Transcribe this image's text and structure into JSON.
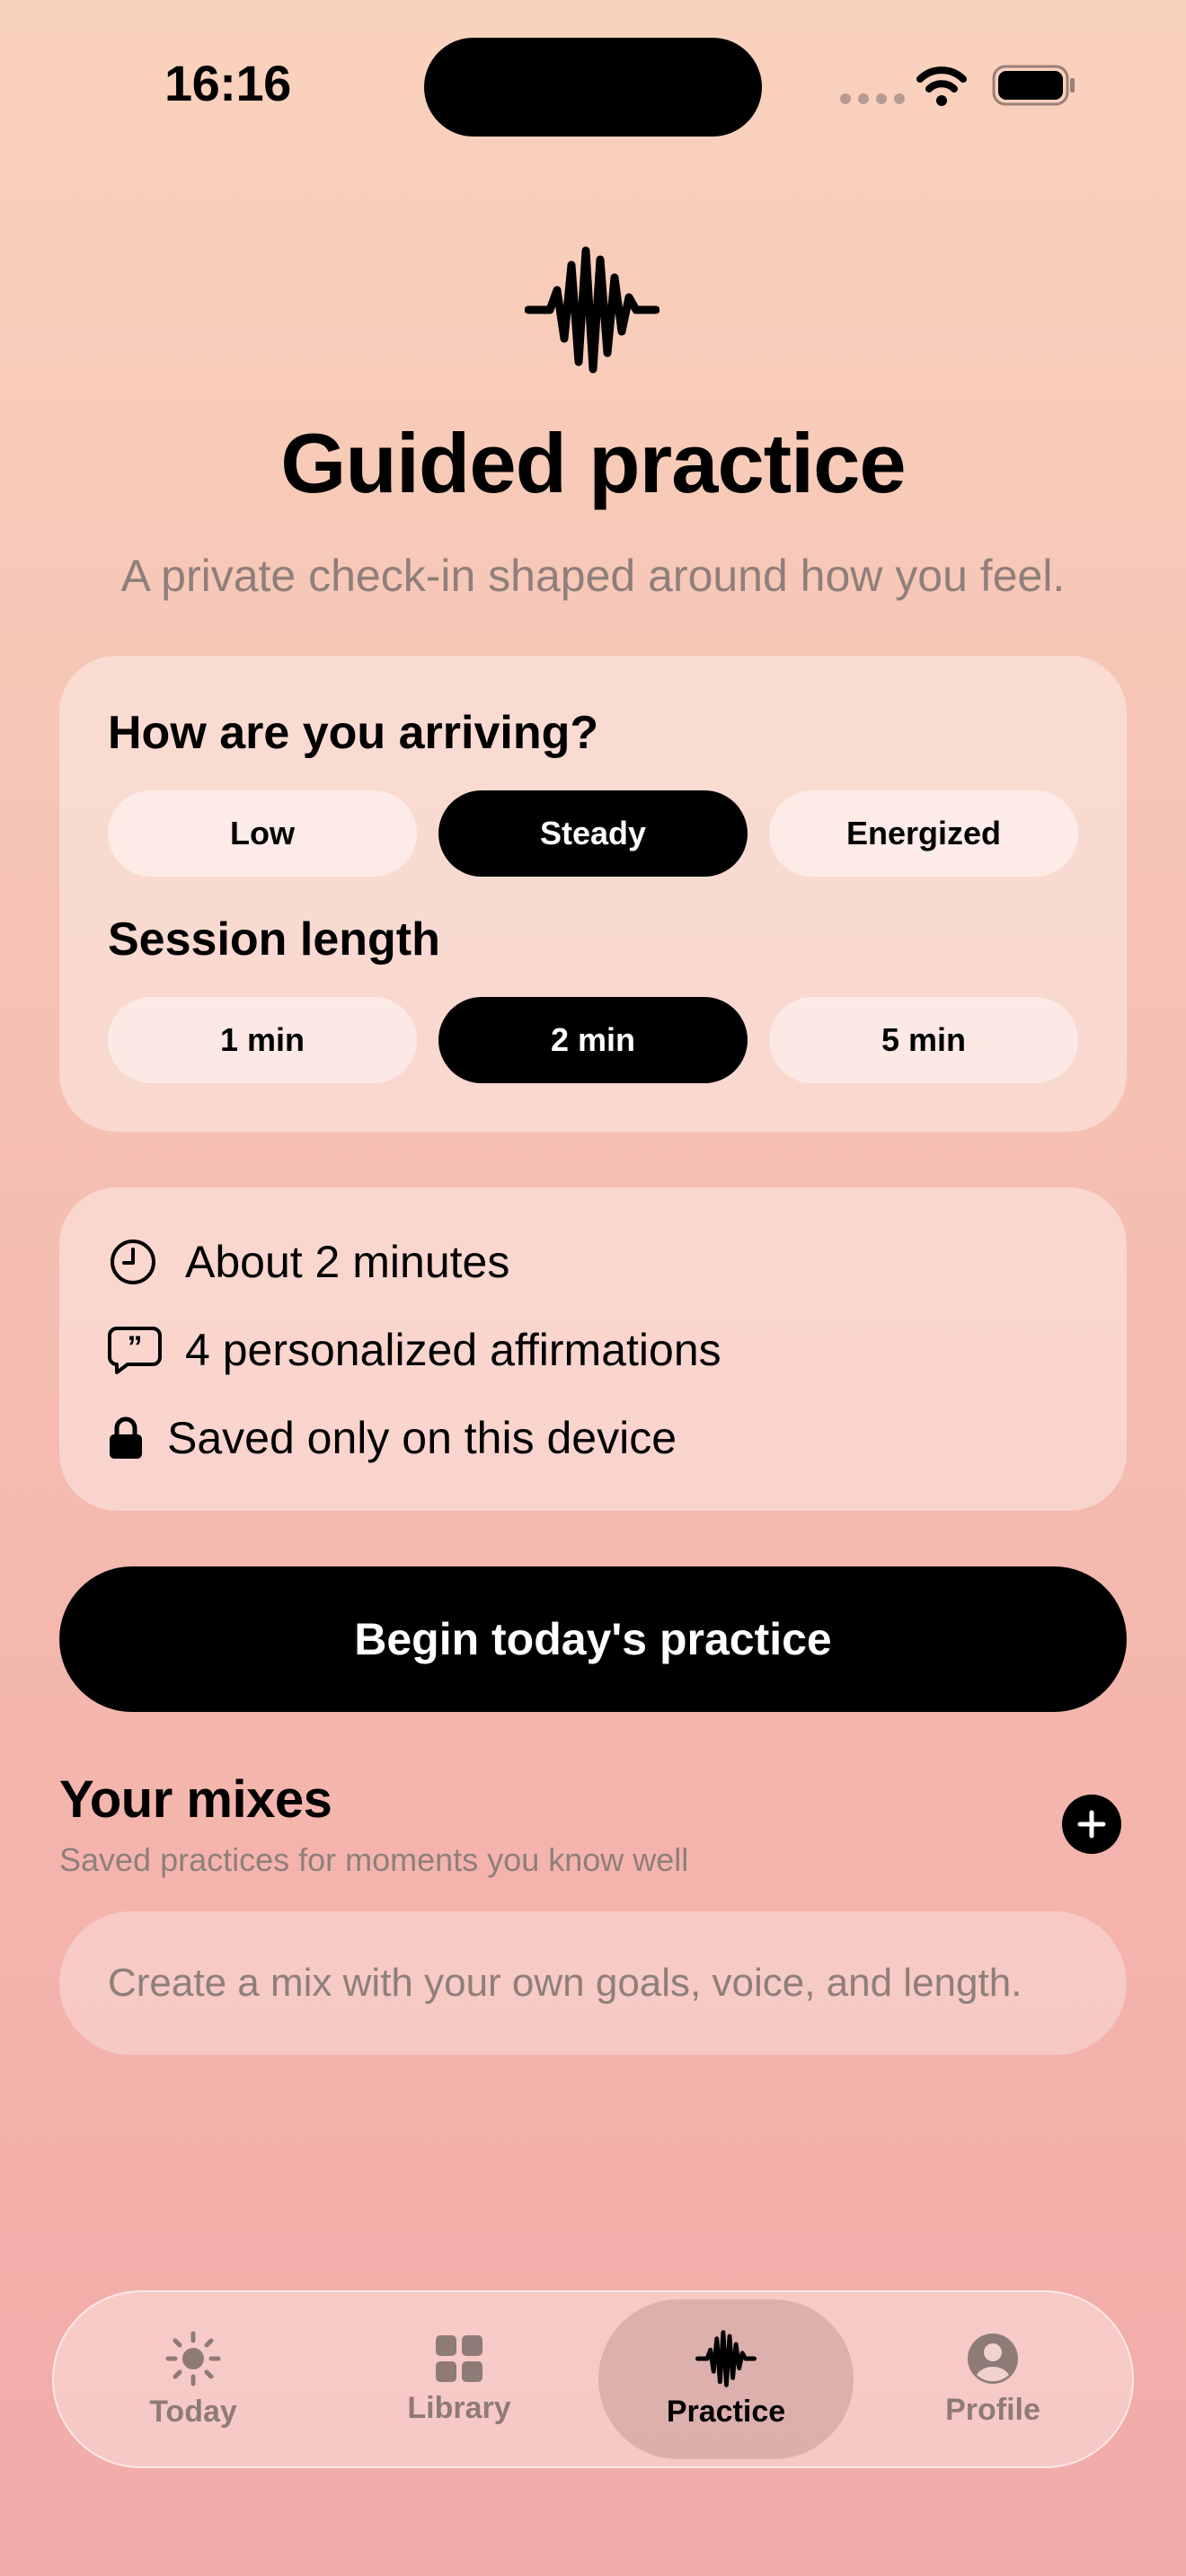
{
  "status_bar": {
    "time": "16:16"
  },
  "header": {
    "title": "Guided practice",
    "subtitle": "A private check-in shaped around how you feel."
  },
  "mood": {
    "label": "How are you arriving?",
    "options": [
      "Low",
      "Steady",
      "Energized"
    ],
    "selected": "Steady"
  },
  "session": {
    "label": "Session length",
    "options": [
      "1 min",
      "2 min",
      "5 min"
    ],
    "selected": "2 min"
  },
  "details": {
    "duration": "About 2 minutes",
    "affirmations": "4 personalized affirmations",
    "privacy": "Saved only on this device"
  },
  "begin_button": "Begin today's practice",
  "mixes": {
    "title": "Your mixes",
    "subtitle": "Saved practices for moments you know well",
    "empty_text": "Create a mix with your own goals, voice, and length."
  },
  "tabs": [
    {
      "label": "Today",
      "icon": "sun-icon"
    },
    {
      "label": "Library",
      "icon": "grid-icon"
    },
    {
      "label": "Practice",
      "icon": "waveform-icon",
      "active": true
    },
    {
      "label": "Profile",
      "icon": "person-circle-icon"
    }
  ],
  "colors": {
    "accent": "#000000",
    "muted_text": "#8f7f7b"
  }
}
